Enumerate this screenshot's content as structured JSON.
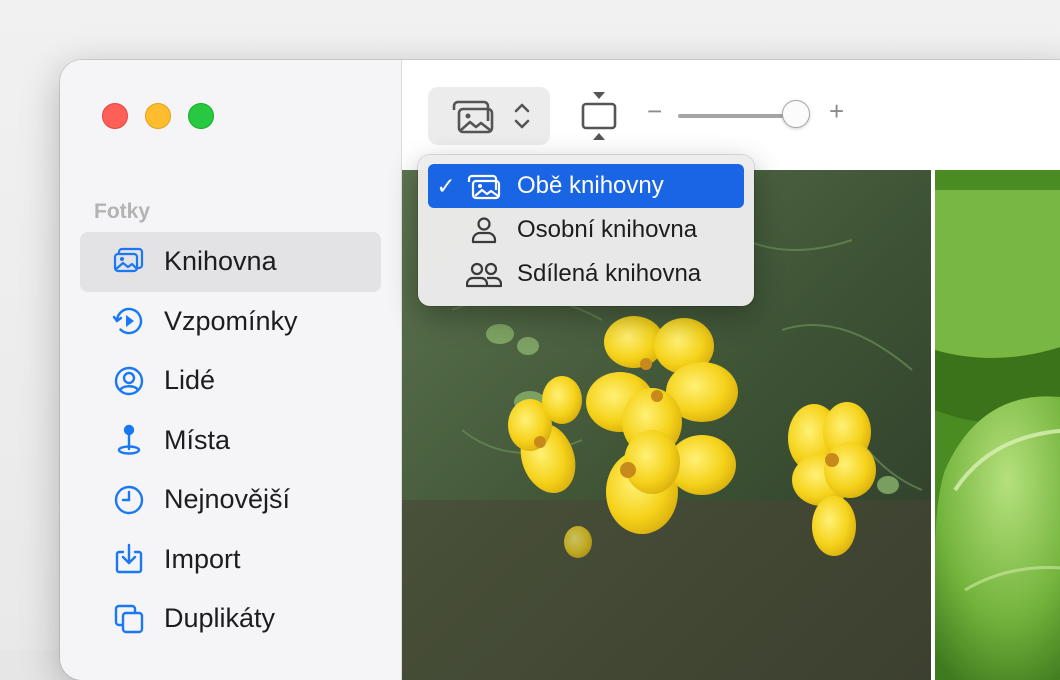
{
  "window": {
    "traffic_lights": [
      "close",
      "minimize",
      "zoom"
    ]
  },
  "sidebar": {
    "section_label": "Fotky",
    "items": [
      {
        "label": "Knihovna",
        "icon": "library-icon",
        "selected": true
      },
      {
        "label": "Vzpomínky",
        "icon": "memories-icon",
        "selected": false
      },
      {
        "label": "Lidé",
        "icon": "people-icon",
        "selected": false
      },
      {
        "label": "Místa",
        "icon": "places-icon",
        "selected": false
      },
      {
        "label": "Nejnovější",
        "icon": "recents-icon",
        "selected": false
      },
      {
        "label": "Import",
        "icon": "import-icon",
        "selected": false
      },
      {
        "label": "Duplikáty",
        "icon": "duplicates-icon",
        "selected": false
      }
    ]
  },
  "toolbar": {
    "library_picker_icon": "photo-library-icon",
    "zoom_minus": "−",
    "zoom_plus": "+",
    "zoom_level": 0.95
  },
  "library_menu": {
    "items": [
      {
        "label": "Obě knihovny",
        "icon": "both-libraries-icon",
        "checked": true
      },
      {
        "label": "Osobní knihovna",
        "icon": "person-icon",
        "checked": false
      },
      {
        "label": "Sdílená knihovna",
        "icon": "two-people-icon",
        "checked": false
      }
    ],
    "check_mark": "✓"
  },
  "colors": {
    "accent": "#1a65e4",
    "sidebar_icon": "#1978f3",
    "close": "#fe5f57",
    "minimize": "#febc2e",
    "zoom": "#28c840"
  }
}
